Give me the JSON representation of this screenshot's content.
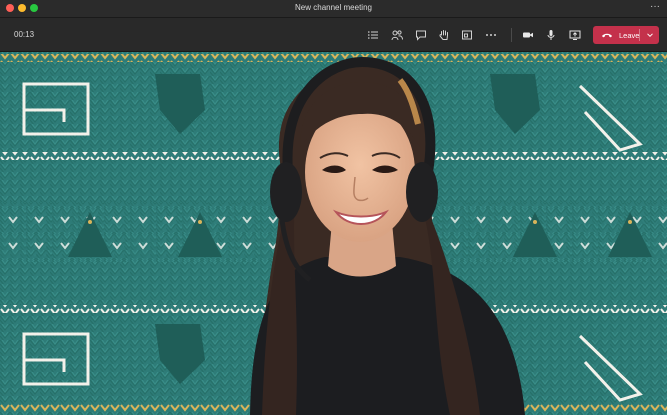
{
  "window": {
    "title": "New channel meeting",
    "traffic_lights": [
      "#ff5f57",
      "#febc2e",
      "#28c840"
    ],
    "more_icon": "ellipsis-icon"
  },
  "toolbar": {
    "timer": "00:13",
    "icons": [
      "participants-list-icon",
      "people-icon",
      "chat-icon",
      "raise-hand-icon",
      "share-tray-icon",
      "more-actions-icon",
      "camera-icon",
      "microphone-icon",
      "share-screen-icon"
    ],
    "leave_label": "Leave",
    "leave_color": "#c4314b"
  },
  "video": {
    "background_color": "#2f7f7a"
  }
}
